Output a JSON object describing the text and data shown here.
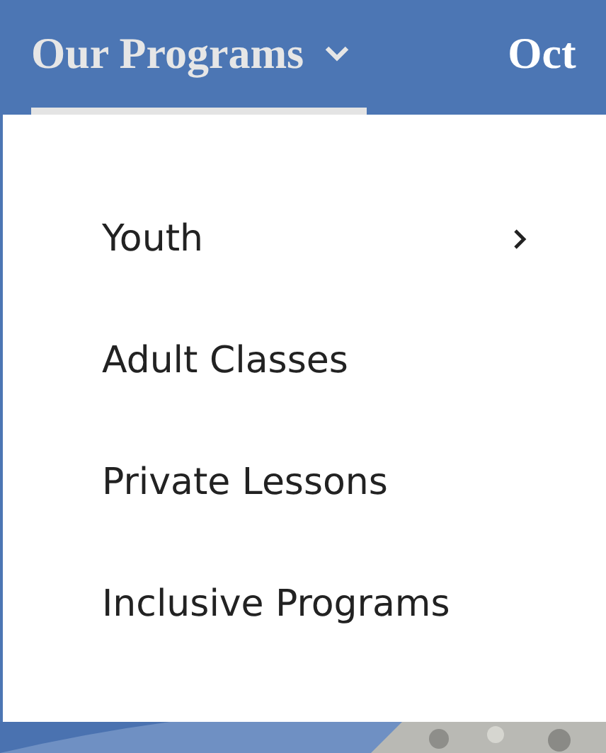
{
  "nav": {
    "items": [
      {
        "label": "Our Programs",
        "selected": true,
        "expanded": true
      },
      {
        "label": "Oct",
        "selected": false
      }
    ]
  },
  "dropdown": {
    "items": [
      {
        "label": "Youth",
        "has_submenu": true
      },
      {
        "label": "Adult Classes",
        "has_submenu": false
      },
      {
        "label": "Private Lessons",
        "has_submenu": false
      },
      {
        "label": "Inclusive Programs",
        "has_submenu": false
      }
    ]
  }
}
